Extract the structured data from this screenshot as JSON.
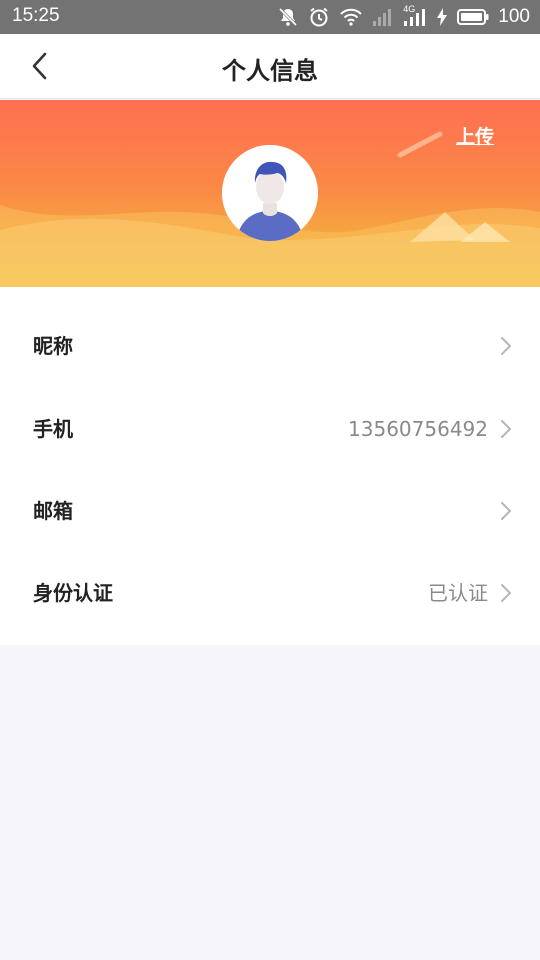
{
  "status_bar": {
    "time": "15:25",
    "network_label": "4G",
    "battery": "100",
    "icons": [
      "mute-bell-icon",
      "alarm-icon",
      "wifi-icon",
      "signal-icon",
      "signal-4g-icon",
      "charging-icon",
      "battery-icon"
    ]
  },
  "header": {
    "title": "个人信息",
    "back_icon": "chevron-left-icon"
  },
  "banner": {
    "upload_label": "上传",
    "avatar_icon": "default-user-avatar",
    "gradient_top": "#ff6f52",
    "gradient_bottom": "#f4b640"
  },
  "profile": {
    "items": [
      {
        "label": "昵称",
        "value": ""
      },
      {
        "label": "手机",
        "value": "13560756492"
      },
      {
        "label": "邮箱",
        "value": ""
      },
      {
        "label": "身份认证",
        "value": "已认证"
      }
    ]
  },
  "colors": {
    "page_background": "#f6f6fa",
    "avatar_shirt": "#5a6cc4",
    "avatar_hair": "#3f55b8"
  }
}
